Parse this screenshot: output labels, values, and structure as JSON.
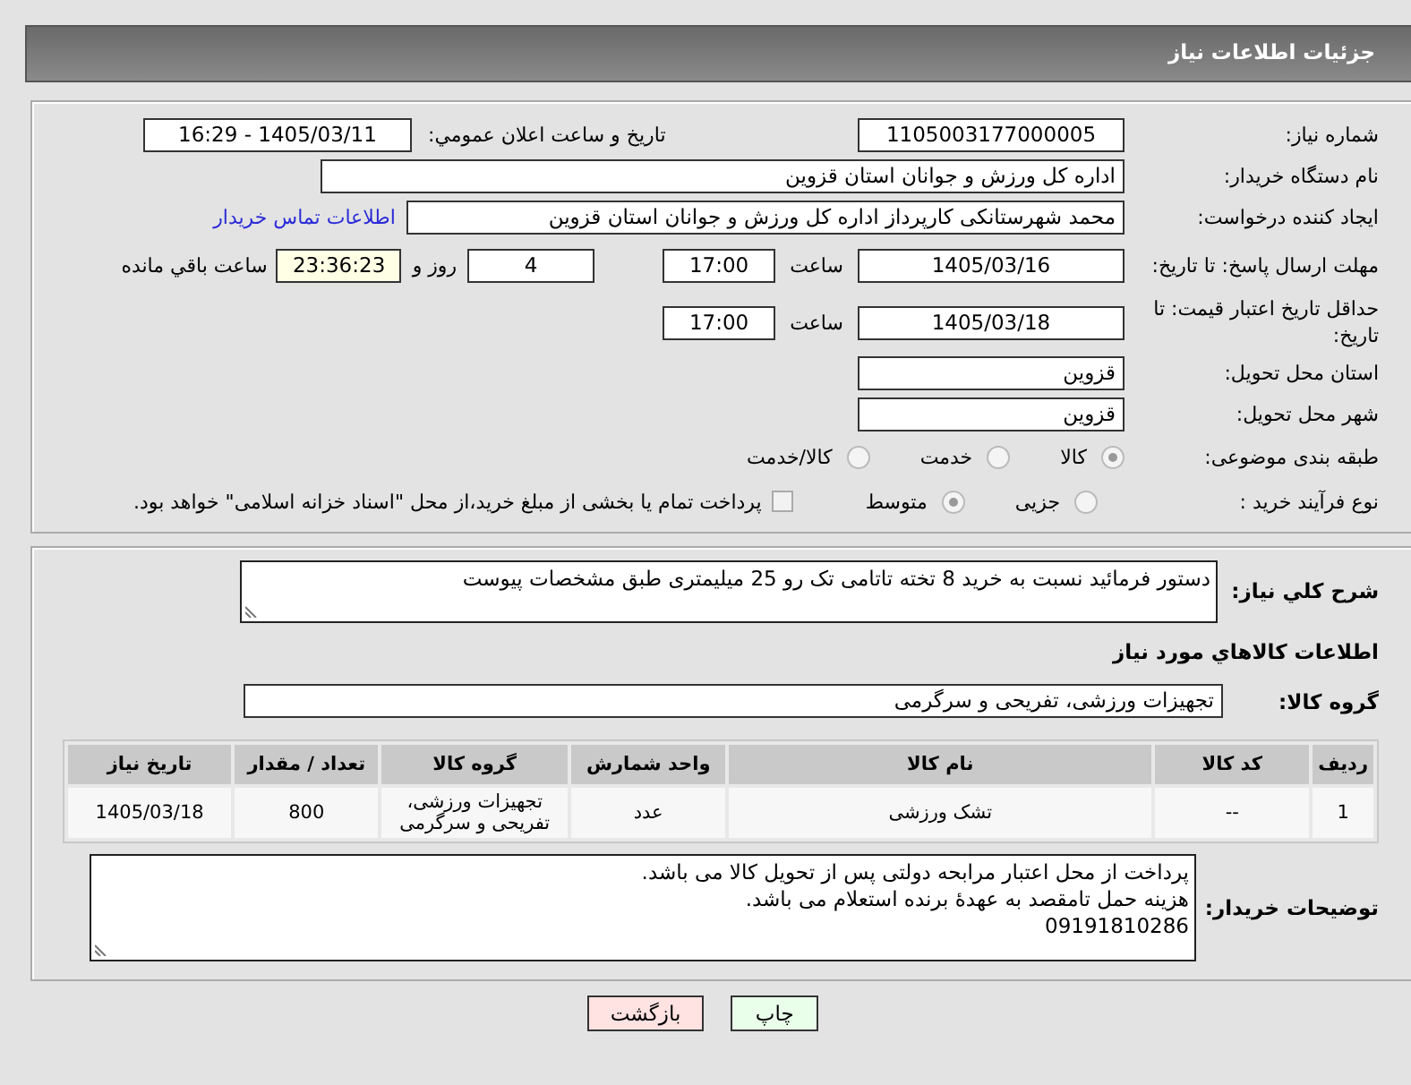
{
  "header": {
    "title": "جزئیات اطلاعات نیاز"
  },
  "details": {
    "need_number": {
      "label": "شماره نیاز:",
      "value": "1105003177000005"
    },
    "announce": {
      "label": "تاریخ و ساعت اعلان عمومي:",
      "value": "1405/03/11 - 16:29"
    },
    "buyer": {
      "label": "نام دستگاه خریدار:",
      "value": "اداره کل ورزش و جوانان استان قزوین"
    },
    "creator": {
      "label": "ایجاد کننده درخواست:",
      "value": "محمد شهرستانکی کارپرداز اداره کل ورزش و جوانان استان قزوین",
      "link": "اطلاعات تماس خریدار"
    },
    "reply_deadline": {
      "label": "مهلت ارسال پاسخ: تا تاریخ:",
      "date": "1405/03/16",
      "time_label": "ساعت",
      "time": "17:00",
      "days": "4",
      "days_label": "روز و",
      "remaining": "23:36:23",
      "remaining_label": "ساعت باقي مانده"
    },
    "price_validity": {
      "label": "حداقل تاریخ اعتبار قیمت: تا تاریخ:",
      "date": "1405/03/18",
      "time_label": "ساعت",
      "time": "17:00"
    },
    "province": {
      "label": "استان محل تحویل:",
      "value": "قزوین"
    },
    "city": {
      "label": "شهر محل تحویل:",
      "value": "قزوین"
    },
    "category": {
      "label": "طبقه بندی موضوعی:",
      "options": [
        {
          "label": "کالا",
          "selected": true
        },
        {
          "label": "خدمت",
          "selected": false
        },
        {
          "label": "کالا/خدمت",
          "selected": false
        }
      ]
    },
    "process": {
      "label": "نوع فرآیند خرید :",
      "options": [
        {
          "label": "جزیی",
          "selected": false
        },
        {
          "label": "متوسط",
          "selected": true
        }
      ],
      "payment": {
        "label": "پرداخت تمام یا بخشی از مبلغ خرید،از محل \"اسناد خزانه اسلامی\" خواهد بود.",
        "checked": false
      }
    }
  },
  "items": {
    "description": {
      "label": "شرح كلي نياز:",
      "value": "دستور فرمائید نسبت به خرید 8 تخته تاتامی تک رو  25 میلیمتری طبق مشخصات پیوست"
    },
    "heading": "اطلاعات كالاهاي مورد نياز",
    "group": {
      "label": "گروه کالا:",
      "value": "تجهیزات ورزشی، تفریحی و سرگرمی"
    },
    "table": {
      "columns": [
        "ردیف",
        "کد کالا",
        "نام کالا",
        "واحد شمارش",
        "گروه کالا",
        "تعداد / مقدار",
        "تاریخ نیاز"
      ],
      "rows": [
        [
          "1",
          "--",
          "تشک ورزشی",
          "عدد",
          "تجهیزات ورزشی، تفریحی و سرگرمی",
          "800",
          "1405/03/18"
        ]
      ]
    },
    "notes": {
      "label": "توضیحات خریدار:",
      "value": "پرداخت از محل اعتبار مرابحه دولتی پس از تحویل کالا می باشد.\nهزینه حمل تامقصد به عهدهٔ برنده استعلام می باشد.\n09191810286"
    }
  },
  "buttons": [
    {
      "label": "چاپ",
      "kind": "print"
    },
    {
      "label": "بازگشت",
      "kind": "back"
    }
  ]
}
